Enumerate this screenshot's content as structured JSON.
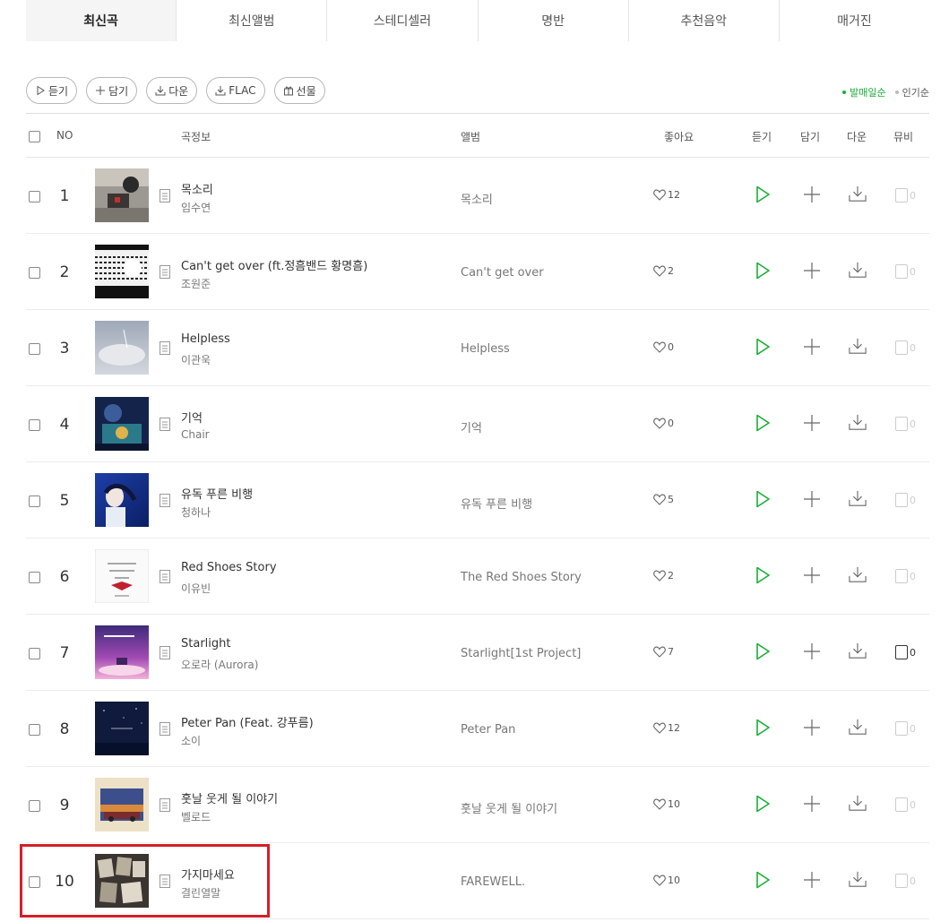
{
  "tabs": [
    {
      "label": "최신곡",
      "active": true
    },
    {
      "label": "최신앨범",
      "active": false
    },
    {
      "label": "스테디셀러",
      "active": false
    },
    {
      "label": "명반",
      "active": false
    },
    {
      "label": "추천음악",
      "active": false
    },
    {
      "label": "매거진",
      "active": false
    }
  ],
  "toolbar": {
    "listen_label": "듣기",
    "add_label": "담기",
    "download_label": "다운",
    "flac_label": "FLAC",
    "gift_label": "선물"
  },
  "sort": {
    "by_release_label": "발매일순",
    "by_popularity_label": "인기순",
    "selected": "발매일순"
  },
  "table_headers": {
    "no": "NO",
    "song_info": "곡정보",
    "album": "앨범",
    "likes": "좋아요",
    "listen": "듣기",
    "add": "담기",
    "download": "다운",
    "mv": "뮤비"
  },
  "songs": [
    {
      "rank": "1",
      "title": "목소리",
      "artist": "임수연",
      "album": "목소리",
      "likes": "12",
      "mv": "0"
    },
    {
      "rank": "2",
      "title": "Can't get over (ft.정흠밴드 황명흠)",
      "artist": "조원준",
      "album": "Can't get over",
      "likes": "2",
      "mv": "0"
    },
    {
      "rank": "3",
      "title": "Helpless",
      "artist": "이관욱",
      "album": "Helpless",
      "likes": "0",
      "mv": "0"
    },
    {
      "rank": "4",
      "title": "기억",
      "artist": "Chair",
      "album": "기억",
      "likes": "0",
      "mv": "0"
    },
    {
      "rank": "5",
      "title": "유독 푸른 비행",
      "artist": "청하나",
      "album": "유독 푸른 비행",
      "likes": "5",
      "mv": "0"
    },
    {
      "rank": "6",
      "title": "Red Shoes Story",
      "artist": "이유빈",
      "album": "The Red Shoes Story",
      "likes": "2",
      "mv": "0"
    },
    {
      "rank": "7",
      "title": "Starlight",
      "artist": "오로라 (Aurora)",
      "album": "Starlight[1st Project]",
      "likes": "7",
      "mv": "0"
    },
    {
      "rank": "8",
      "title": "Peter Pan (Feat. 강푸름)",
      "artist": "소이",
      "album": "Peter Pan",
      "likes": "12",
      "mv": "0"
    },
    {
      "rank": "9",
      "title": "훗날 웃게 될 이야기",
      "artist": "벨로드",
      "album": "훗날 웃게 될 이야기",
      "likes": "10",
      "mv": "0"
    },
    {
      "rank": "10",
      "title": "가지마세요",
      "artist": "결린열말",
      "album": "FAREWELL.",
      "likes": "10",
      "mv": "0"
    }
  ],
  "colors": {
    "accent_green": "#1aae36",
    "highlight_red": "#d41f28"
  }
}
